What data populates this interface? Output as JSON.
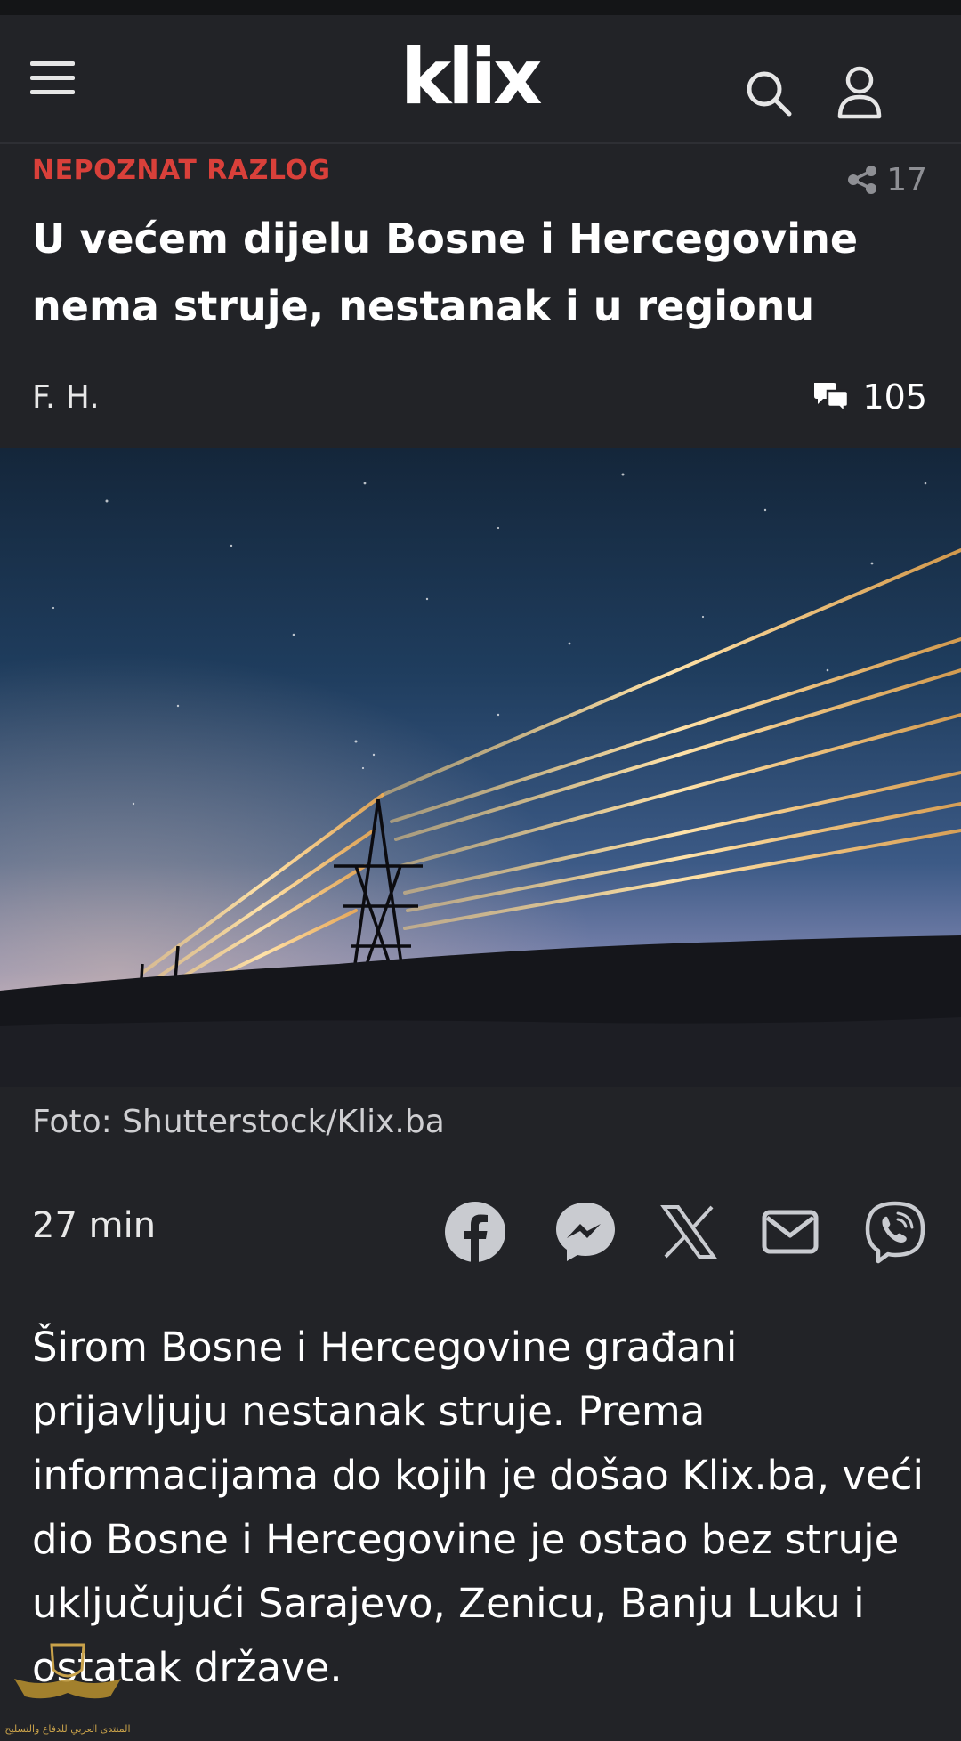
{
  "app": {
    "logo_text": "klix"
  },
  "article": {
    "kicker": "NEPOZNAT RAZLOG",
    "share_count": "17",
    "headline": "U većem dijelu Bosne i Hercegovine nema struje, nestanak i u regionu",
    "author": "F. H.",
    "comment_count": "105",
    "photo_caption": "Foto: Shutterstock/Klix.ba",
    "time_ago": "27 min",
    "lead": "Širom Bosne i Hercegovine građani prijavljuju nestanak struje. Prema informacijama do kojih je došao Klix.ba, veći dio Bosne i Hercegovine je ostao bez struje uključujući Sarajevo, Zenicu, Banju Luku i ostatak države."
  },
  "share_buttons": [
    "facebook-icon",
    "messenger-icon",
    "x-icon",
    "email-icon",
    "viber-icon"
  ],
  "colors": {
    "background": "#222327",
    "kicker": "#d9403a",
    "text": "#ffffff",
    "muted": "#8e8f94"
  },
  "watermark": {
    "text": "المنتدى العربي للدفاع والتسليح"
  }
}
